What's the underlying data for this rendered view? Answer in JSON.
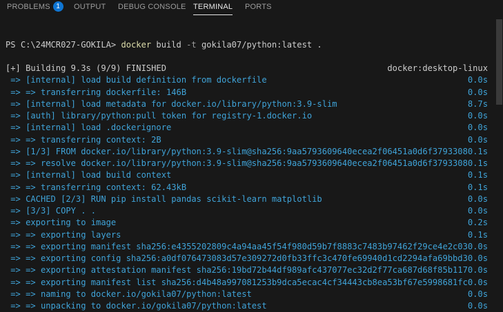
{
  "tabs": [
    {
      "label": "PROBLEMS",
      "badge": "1"
    },
    {
      "label": "OUTPUT"
    },
    {
      "label": "DEBUG CONSOLE"
    },
    {
      "label": "TERMINAL"
    },
    {
      "label": "PORTS"
    }
  ],
  "terminal": {
    "prompt": "PS C:\\24MCR027-GOKILA>",
    "command": "docker",
    "command_args": " build ",
    "flag": "-t",
    "command_rest": " gokila07/python:latest .",
    "lines": [
      {
        "text": "[+] Building 9.3s (9/9) FINISHED",
        "right": "docker:desktop-linux",
        "style": "white"
      },
      {
        "text": " => [internal] load build definition from dockerfile",
        "right": "0.0s"
      },
      {
        "text": " => => transferring dockerfile: 146B",
        "right": "0.0s"
      },
      {
        "text": " => [internal] load metadata for docker.io/library/python:3.9-slim",
        "right": "8.7s"
      },
      {
        "text": " => [auth] library/python:pull token for registry-1.docker.io",
        "right": "0.0s"
      },
      {
        "text": " => [internal] load .dockerignore",
        "right": "0.0s"
      },
      {
        "text": " => => transferring context: 2B",
        "right": "0.0s"
      },
      {
        "text": " => [1/3] FROM docker.io/library/python:3.9-slim@sha256:9aa5793609640ecea2f06451a0d6f3793308",
        "right": "0.1s"
      },
      {
        "text": " => => resolve docker.io/library/python:3.9-slim@sha256:9aa5793609640ecea2f06451a0d6f3793308",
        "right": "0.1s"
      },
      {
        "text": " => [internal] load build context",
        "right": "0.1s"
      },
      {
        "text": " => => transferring context: 62.43kB",
        "right": "0.1s"
      },
      {
        "text": " => CACHED [2/3] RUN pip install pandas scikit-learn matplotlib",
        "right": "0.0s"
      },
      {
        "text": " => [3/3] COPY . .",
        "right": "0.0s"
      },
      {
        "text": " => exporting to image",
        "right": "0.2s"
      },
      {
        "text": " => => exporting layers",
        "right": "0.1s"
      },
      {
        "text": " => => exporting manifest sha256:e4355202809c4a94aa45f54f980d59b7f8883c7483b97462f29ce4e2c03",
        "right": "0.0s"
      },
      {
        "text": " => => exporting config sha256:a0df076473083d57e309272d0fb33ffc3c470fe69940d1cd2294afa69bbd3",
        "right": "0.0s"
      },
      {
        "text": " => => exporting attestation manifest sha256:19bd72b44df989afc437077ec32d2f77ca687d68f85b117",
        "right": "0.0s"
      },
      {
        "text": " => => exporting manifest list sha256:d4b48a997081253b9dca5ecac4cf34443cb8ea53bf67e5998681fc",
        "right": "0.0s"
      },
      {
        "text": " => => naming to docker.io/gokila07/python:latest",
        "right": "0.0s"
      },
      {
        "text": " => => unpacking to docker.io/gokila07/python:latest",
        "right": "0.0s"
      }
    ]
  },
  "colors": {
    "background": "#181818",
    "accent": "#3fa3d8",
    "badge": "#0e75d3",
    "command": "#dcdcaa"
  }
}
